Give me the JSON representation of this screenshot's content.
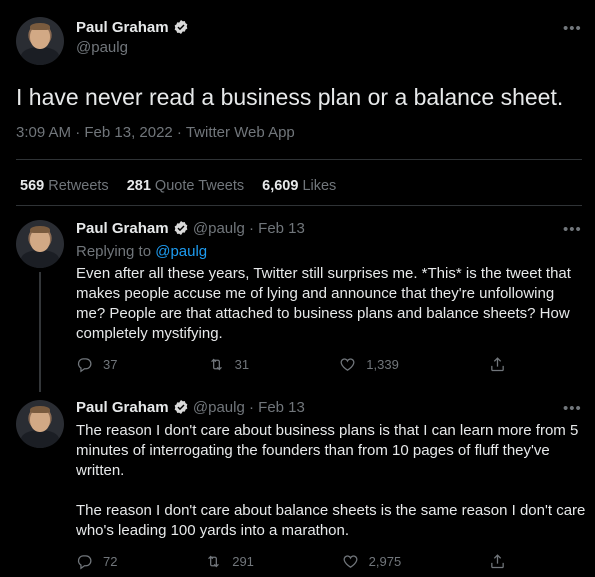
{
  "main_tweet": {
    "author_name": "Paul Graham",
    "handle": "@paulg",
    "text": "I have never read a business plan or a balance sheet.",
    "timestamp": "3:09 AM · Feb 13, 2022 · Twitter Web App",
    "stats": {
      "retweets_count": "569",
      "retweets_label": "Retweets",
      "quotes_count": "281",
      "quotes_label": "Quote Tweets",
      "likes_count": "6,609",
      "likes_label": "Likes"
    },
    "more_icon": "more-dots-icon"
  },
  "replies": [
    {
      "author_name": "Paul Graham",
      "handle": "@paulg",
      "date": "Feb 13",
      "replying_prefix": "Replying to",
      "replying_to": "@paulg",
      "text": "Even after all these years, Twitter still surprises me. *This* is the tweet that makes people accuse me of lying and announce that they're unfollowing me? People are that attached to business plans and balance sheets? How completely mystifying.",
      "replies": "37",
      "retweets": "31",
      "likes": "1,339"
    },
    {
      "author_name": "Paul Graham",
      "handle": "@paulg",
      "date": "Feb 13",
      "text1": "The reason I don't care about business plans is that I can learn more from 5 minutes of interrogating the founders than from 10 pages of fluff they've written.",
      "text2": "The reason I don't care about balance sheets is the same reason I don't care who's leading 100 yards into a marathon.",
      "replies": "72",
      "retweets": "291",
      "likes": "2,975"
    }
  ],
  "colors": {
    "background": "#000000",
    "text": "#e7e9ea",
    "muted": "#71767b",
    "link": "#1d9bf0",
    "divider": "#2f3336"
  }
}
